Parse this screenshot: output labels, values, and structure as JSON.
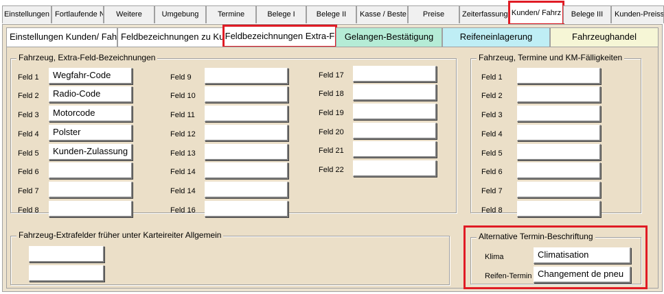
{
  "tabs_top": [
    {
      "label": "Einstellungen"
    },
    {
      "label": "Fortlaufende N"
    },
    {
      "label": "Weitere"
    },
    {
      "label": "Umgebung"
    },
    {
      "label": "Termine"
    },
    {
      "label": "Belege I"
    },
    {
      "label": "Belege II"
    },
    {
      "label": "Kasse / Beste"
    },
    {
      "label": "Preise"
    },
    {
      "label": "Zeiterfassung"
    },
    {
      "label": "Kunden/ Fahrz",
      "active": true,
      "highlighted": true
    },
    {
      "label": "Belege III"
    },
    {
      "label": "Kunden-Preisst"
    }
  ],
  "subtabs": [
    {
      "label": "Einstellungen Kunden/ Fahr",
      "color": "#ffffff"
    },
    {
      "label": "Feldbezeichnungen zu Kund",
      "color": "#ffffff"
    },
    {
      "label": "Feldbezeichnungen Extra-F",
      "color": "#ffffff",
      "active": true,
      "highlighted": true
    },
    {
      "label": "Gelangen-Bestätigung",
      "color": "#b5ecd6"
    },
    {
      "label": "Reifeneinlagerung",
      "color": "#bfeef5"
    },
    {
      "label": "Fahrzeughandel",
      "color": "#f6f6d6"
    }
  ],
  "extra_fields": {
    "legend": "Fahrzeug, Extra-Feld-Bezeichnungen",
    "fields": [
      {
        "label": "Feld 1",
        "value": "Wegfahr-Code"
      },
      {
        "label": "Feld 2",
        "value": "Radio-Code"
      },
      {
        "label": "Feld 3",
        "value": "Motorcode"
      },
      {
        "label": "Feld 4",
        "value": "Polster"
      },
      {
        "label": "Feld 5",
        "value": "Kunden-Zulassung"
      },
      {
        "label": "Feld 6",
        "value": ""
      },
      {
        "label": "Feld 7",
        "value": ""
      },
      {
        "label": "Feld 8",
        "value": ""
      },
      {
        "label": "Feld 9",
        "value": ""
      },
      {
        "label": "Feld 10",
        "value": ""
      },
      {
        "label": "Feld 11",
        "value": ""
      },
      {
        "label": "Feld 12",
        "value": ""
      },
      {
        "label": "Feld 13",
        "value": ""
      },
      {
        "label": "Feld 14",
        "value": ""
      },
      {
        "label": "Feld 14",
        "value": ""
      },
      {
        "label": "Feld 16",
        "value": ""
      },
      {
        "label": "Feld 17",
        "value": ""
      },
      {
        "label": "Feld 18",
        "value": ""
      },
      {
        "label": "Feld 19",
        "value": ""
      },
      {
        "label": "Feld 20",
        "value": ""
      },
      {
        "label": "Feld 21",
        "value": ""
      },
      {
        "label": "Feld 22",
        "value": ""
      }
    ]
  },
  "termine_km": {
    "legend": "Fahrzeug, Termine und KM-Fälligkeiten",
    "fields": [
      {
        "label": "Feld 1",
        "value": ""
      },
      {
        "label": "Feld 2",
        "value": ""
      },
      {
        "label": "Feld 3",
        "value": ""
      },
      {
        "label": "Feld 4",
        "value": ""
      },
      {
        "label": "Feld 5",
        "value": ""
      },
      {
        "label": "Feld 6",
        "value": ""
      },
      {
        "label": "Feld 7",
        "value": ""
      },
      {
        "label": "Feld 8",
        "value": ""
      }
    ]
  },
  "frueher": {
    "legend": "Fahrzeug-Extrafelder früher unter Karteireiter Allgemein",
    "fields": [
      {
        "value": ""
      },
      {
        "value": ""
      }
    ]
  },
  "alt_termin": {
    "legend": "Alternative Termin-Beschriftung",
    "highlighted": true,
    "fields": [
      {
        "label": "Klima",
        "value": "Climatisation"
      },
      {
        "label": "Reifen-Termin",
        "value": "Changement de pneu"
      }
    ]
  }
}
